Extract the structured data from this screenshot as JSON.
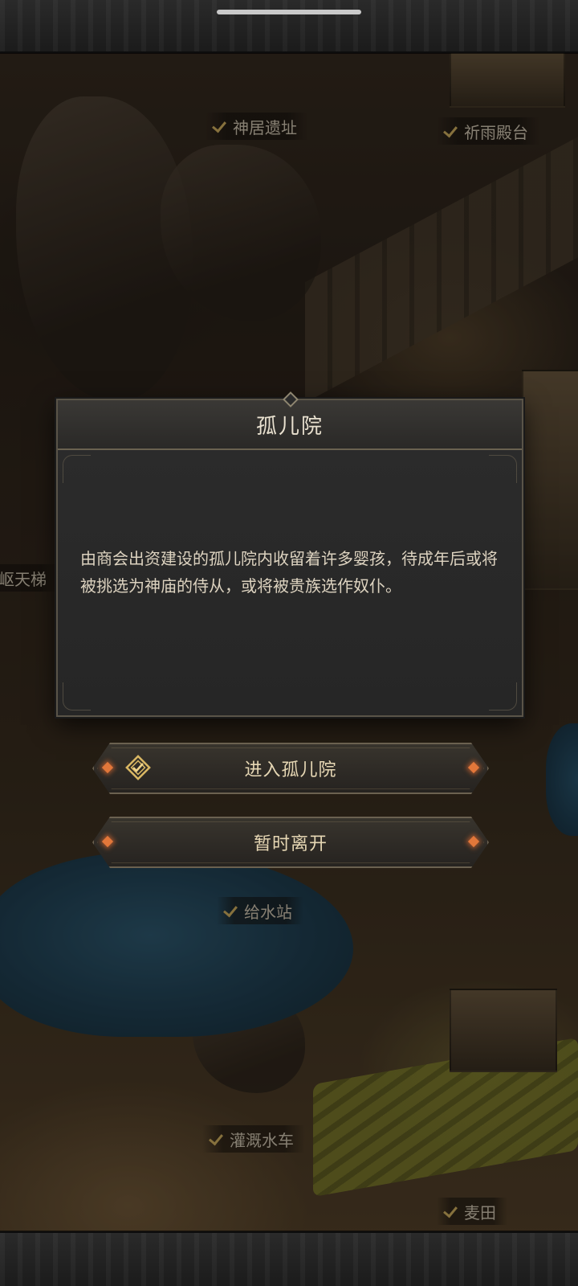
{
  "map": {
    "labels": {
      "shenju": "神居遗址",
      "qiyu": "祈雨殿台",
      "tianti": "崎岖天梯",
      "geishui": "给水站",
      "guangai": "灌溉水车",
      "maitian": "麦田"
    }
  },
  "dialog": {
    "title": "孤儿院",
    "description": "由商会出资建设的孤儿院内收留着许多婴孩，待成年后或将被挑选为神庙的侍从，或将被贵族选作奴仆。"
  },
  "buttons": {
    "enter_label": "进入孤儿院",
    "leave_label": "暂时离开"
  },
  "colors": {
    "accent_gold": "#d9b763",
    "gem_orange": "#e2773a"
  }
}
